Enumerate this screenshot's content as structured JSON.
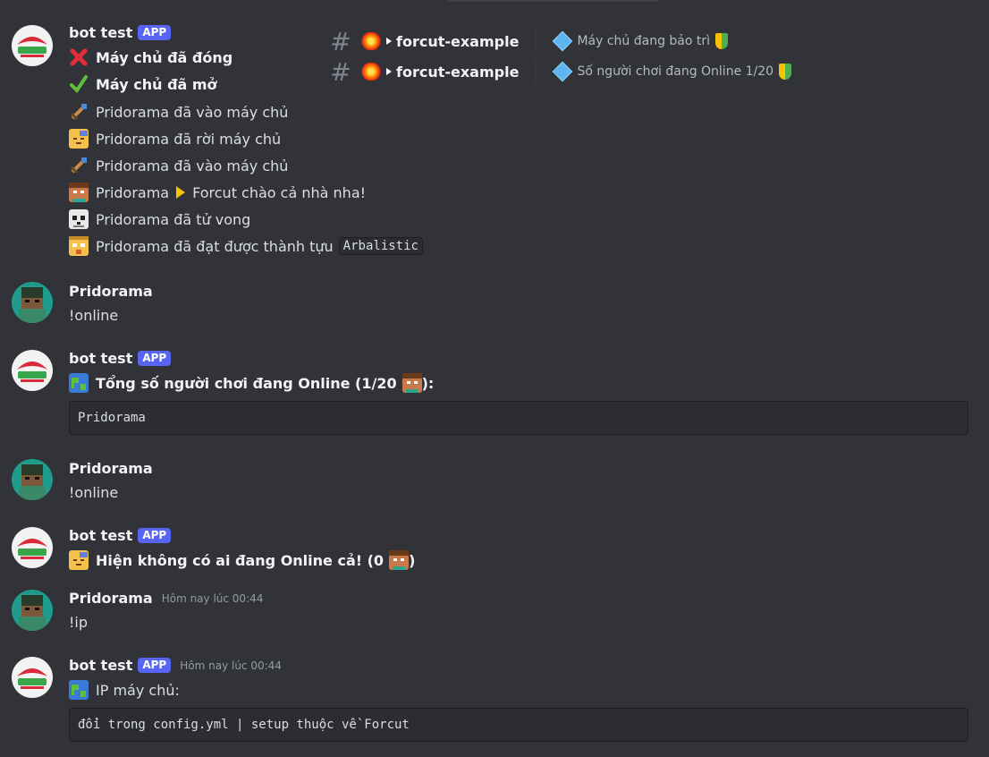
{
  "bot_name": "bot test",
  "app_badge": "APP",
  "user_name": "Pridorama",
  "timestamp": "Hôm nay lúc 00:44",
  "channels": [
    {
      "name": "forcut-example",
      "topic": "Máy chủ đang bảo trì"
    },
    {
      "name": "forcut-example",
      "topic": "Số người chơi đang Online 1/20"
    }
  ],
  "msg1_lines": [
    "Máy chủ đã đóng",
    "Máy chủ đã mở",
    "Pridorama đã vào máy chủ",
    "Pridorama đã rời máy chủ",
    "Pridorama đã vào máy chủ",
    "Pridorama",
    "Forcut chào cả nhà nha!",
    "Pridorama đã tử vong",
    "Pridorama đã đạt được thành tựu",
    "Arbalistic"
  ],
  "user_cmd_online": "!online",
  "msg_online_title": "Tổng số người chơi đang Online (1/20",
  "msg_online_suffix": "):",
  "online_list": "Pridorama",
  "msg_no_online": "Hiện không có ai đang Online cả! (0",
  "msg_no_online_suffix": ")",
  "user_cmd_ip": "!ip",
  "ip_title": "IP máy chủ:",
  "ip_code": "đổi trong config.yml | setup thuộc về Forcut",
  "colors": {
    "background": "#313338",
    "app_badge": "#5865f2",
    "code_bg": "#2b2d31"
  },
  "icons": [
    "hashtag-icon",
    "explosion-icon",
    "diamond-icon",
    "beginner-shield-icon",
    "cross-mark-icon",
    "check-mark-icon",
    "sword-icon",
    "sleepy-face-icon",
    "player-face-icon",
    "play-arrow-icon",
    "skull-icon",
    "trophy-face-icon",
    "globe-icon"
  ]
}
